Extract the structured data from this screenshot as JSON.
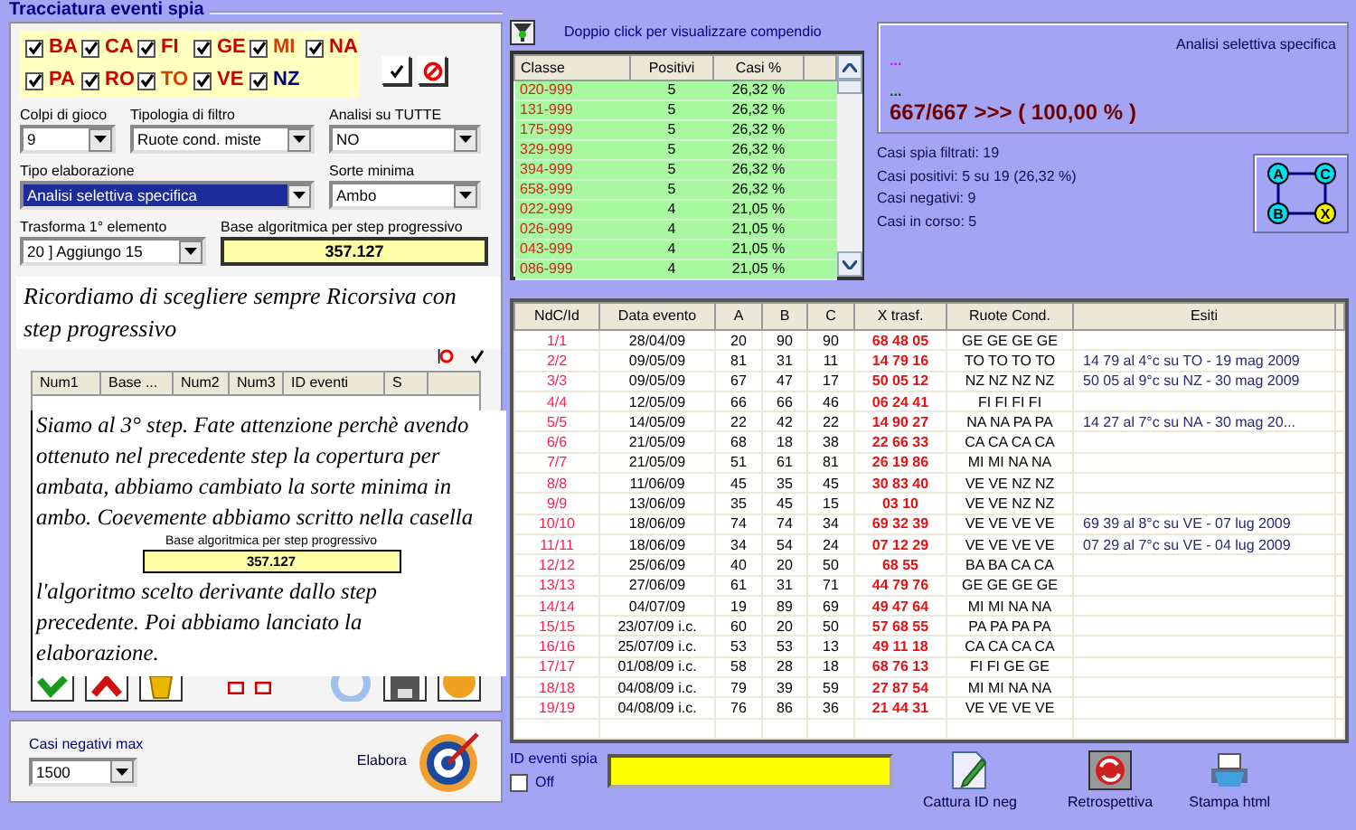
{
  "window": {
    "title": "Tracciatura eventi spia"
  },
  "wheels": [
    {
      "label": "BA",
      "checked": true,
      "color": "#cc0000"
    },
    {
      "label": "CA",
      "checked": true,
      "color": "#cc0000"
    },
    {
      "label": "FI",
      "checked": true,
      "color": "#cc0000"
    },
    {
      "label": "GE",
      "checked": true,
      "color": "#cc0000"
    },
    {
      "label": "MI",
      "checked": true,
      "color": "#d04000"
    },
    {
      "label": "NA",
      "checked": true,
      "color": "#cc0000"
    },
    {
      "label": "PA",
      "checked": true,
      "color": "#cc0000"
    },
    {
      "label": "RO",
      "checked": true,
      "color": "#cc0000"
    },
    {
      "label": "TO",
      "checked": true,
      "color": "#d04000"
    },
    {
      "label": "VE",
      "checked": true,
      "color": "#cc0000"
    },
    {
      "label": "NZ",
      "checked": true,
      "color": "#000080"
    }
  ],
  "fields": [
    {
      "label": "Colpi di gioco",
      "value": "9",
      "kind": "select",
      "focused": false
    },
    {
      "label": "Tipologia di filtro",
      "value": "Ruote cond. miste",
      "kind": "select",
      "focused": false
    },
    {
      "label": "Analisi su TUTTE",
      "value": "NO",
      "kind": "select",
      "focused": false
    },
    {
      "label": "Tipo elaborazione",
      "value": "Analisi selettiva specifica",
      "kind": "select",
      "focused": true
    },
    {
      "label": "Sorte minima",
      "value": "Ambo",
      "kind": "select",
      "focused": false
    },
    {
      "label": "Trasforma 1° elemento",
      "value": "20 ] Aggiungo 15",
      "kind": "select",
      "focused": false
    },
    {
      "label": "Base algoritmica per step progressivo",
      "value": "357.127",
      "kind": "readout"
    }
  ],
  "note": "Ricordiamo di scegliere sempre Ricorsiva con step progressivo",
  "events_table": {
    "columns": [
      "Num1",
      "Base ...",
      "Num2",
      "Num3",
      "ID eventi",
      "S"
    ]
  },
  "overlay": {
    "before": "Siamo al 3° step. Fate attenzione perchè avendo ottenuto nel precedente step la copertura per ambata, abbiamo cambiato la sorte minima in ambo. Coevemente abbiamo scritto nella casella",
    "box_label": "Base algoritmica per step progressivo",
    "box_value": "357.127",
    "after": "l'algoritmo scelto derivante dallo step precedente. Poi abbiamo lanciato la elaborazione."
  },
  "casi_negativi": {
    "label": "Casi negativi max",
    "value": "1500"
  },
  "elabora": "Elabora",
  "compendio_hint": "Doppio click per visualizzare compendio",
  "classes": {
    "columns": [
      "Classe",
      "Positivi",
      "Casi %"
    ],
    "rows": [
      [
        "020-999",
        "5",
        "26,32 %"
      ],
      [
        "131-999",
        "5",
        "26,32 %"
      ],
      [
        "175-999",
        "5",
        "26,32 %"
      ],
      [
        "329-999",
        "5",
        "26,32 %"
      ],
      [
        "394-999",
        "5",
        "26,32 %"
      ],
      [
        "658-999",
        "5",
        "26,32 %"
      ],
      [
        "022-999",
        "4",
        "21,05 %"
      ],
      [
        "026-999",
        "4",
        "21,05 %"
      ],
      [
        "043-999",
        "4",
        "21,05 %"
      ],
      [
        "086-999",
        "4",
        "21,05 %"
      ]
    ]
  },
  "summary": {
    "mode": "Analisi selettiva specifica",
    "line_1": "...",
    "line_2": "...",
    "result": "667/667 >>> ( 100,00 % )"
  },
  "stats": [
    "Casi spia filtrati: 19",
    "Casi positivi: 5 su 19 (26,32 %)",
    "Casi negativi: 9",
    "Casi in corso: 5"
  ],
  "diagram": {
    "nodes": [
      {
        "label": "A",
        "color": "#00e0f0"
      },
      {
        "label": "C",
        "color": "#00e0f0"
      },
      {
        "label": "B",
        "color": "#00e0f0"
      },
      {
        "label": "X",
        "color": "#f0f000"
      }
    ]
  },
  "main_table": {
    "columns": [
      "NdC/Id",
      "Data evento",
      "A",
      "B",
      "C",
      "X trasf.",
      "Ruote Cond.",
      "Esiti"
    ],
    "rows": [
      {
        "id": "1/1",
        "date": "28/04/09",
        "a": "20",
        "b": "90",
        "c": "90",
        "x": "68 48 05",
        "ruote": "GE GE GE GE"
      },
      {
        "id": "2/2",
        "date": "09/05/09",
        "a": "81",
        "b": "31",
        "c": "11",
        "x": "14 79 16",
        "ruote": "TO TO TO TO",
        "esito": "14 79 al 4°c su TO - 19 mag 2009"
      },
      {
        "id": "3/3",
        "date": "09/05/09",
        "a": "67",
        "b": "47",
        "c": "17",
        "x": "50 05 12",
        "ruote": "NZ NZ NZ NZ",
        "esito": "50 05 al 9°c su NZ - 30 mag 2009"
      },
      {
        "id": "4/4",
        "date": "12/05/09",
        "a": "66",
        "b": "66",
        "c": "46",
        "x": "06 24 41",
        "ruote": "FI FI FI FI"
      },
      {
        "id": "5/5",
        "date": "14/05/09",
        "a": "22",
        "b": "42",
        "c": "22",
        "x": "14 90 27",
        "ruote": "NA NA PA PA",
        "esito": "14 27 al 7°c su NA - 30 mag 20..."
      },
      {
        "id": "6/6",
        "date": "21/05/09",
        "a": "68",
        "b": "18",
        "c": "38",
        "x": "22 66 33",
        "ruote": "CA CA CA CA"
      },
      {
        "id": "7/7",
        "date": "21/05/09",
        "a": "51",
        "b": "61",
        "c": "81",
        "x": "26 19 86",
        "ruote": "MI MI NA NA"
      },
      {
        "id": "8/8",
        "date": "11/06/09",
        "a": "45",
        "b": "35",
        "c": "45",
        "x": "30 83 40",
        "ruote": "VE VE NZ NZ"
      },
      {
        "id": "9/9",
        "date": "13/06/09",
        "a": "35",
        "b": "45",
        "c": "15",
        "x": "03 10",
        "ruote": "VE VE NZ NZ"
      },
      {
        "id": "10/10",
        "date": "18/06/09",
        "a": "74",
        "b": "74",
        "c": "34",
        "x": "69 32 39",
        "ruote": "VE VE VE VE",
        "esito": "69 39 al 8°c su VE - 07 lug 2009"
      },
      {
        "id": "11/11",
        "date": "18/06/09",
        "a": "34",
        "b": "54",
        "c": "24",
        "x": "07 12 29",
        "ruote": "VE VE VE VE",
        "esito": "07 29 al 7°c su VE - 04 lug 2009"
      },
      {
        "id": "12/12",
        "date": "25/06/09",
        "a": "40",
        "b": "20",
        "c": "50",
        "x": "68 55",
        "ruote": "BA BA CA CA"
      },
      {
        "id": "13/13",
        "date": "27/06/09",
        "a": "61",
        "b": "31",
        "c": "71",
        "x": "44 79 76",
        "ruote": "GE GE GE GE"
      },
      {
        "id": "14/14",
        "date": "04/07/09",
        "a": "19",
        "b": "89",
        "c": "69",
        "x": "49 47 64",
        "ruote": "MI MI NA NA"
      },
      {
        "id": "15/15",
        "date": "23/07/09 i.c.",
        "a": "60",
        "b": "20",
        "c": "50",
        "x": "57 68 55",
        "ruote": "PA PA PA PA"
      },
      {
        "id": "16/16",
        "date": "25/07/09 i.c.",
        "a": "53",
        "b": "53",
        "c": "13",
        "x": "49 11 18",
        "ruote": "CA CA CA CA"
      },
      {
        "id": "17/17",
        "date": "01/08/09 i.c.",
        "a": "58",
        "b": "28",
        "c": "18",
        "x": "68 76 13",
        "ruote": "FI FI GE GE"
      },
      {
        "id": "18/18",
        "date": "04/08/09 i.c.",
        "a": "79",
        "b": "39",
        "c": "59",
        "x": "27 87 54",
        "ruote": "MI MI NA NA"
      },
      {
        "id": "19/19",
        "date": "04/08/09 i.c.",
        "a": "76",
        "b": "86",
        "c": "36",
        "x": "21 44 31",
        "ruote": "VE VE VE VE"
      }
    ]
  },
  "bottom": {
    "id_label": "ID eventi spia",
    "off": {
      "label": "Off",
      "checked": false
    },
    "buttons": [
      "Cattura ID neg",
      "Retrospettiva",
      "Stampa html"
    ]
  }
}
